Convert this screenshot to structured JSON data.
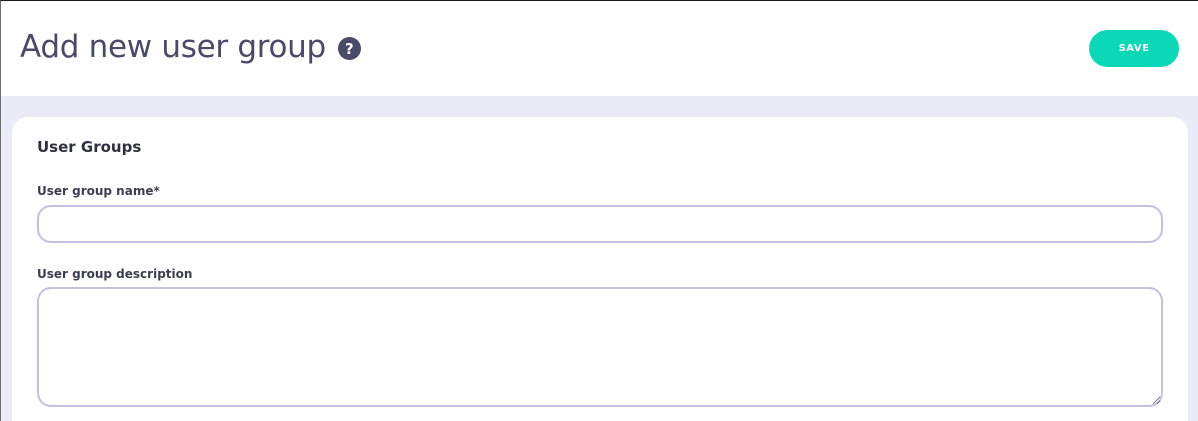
{
  "header": {
    "title": "Add new user group",
    "help_icon": "question-circle-icon",
    "save_label": "SAVE"
  },
  "form": {
    "section_title": "User Groups",
    "name_label": "User group name*",
    "name_value": "",
    "description_label": "User group description",
    "description_value": ""
  },
  "colors": {
    "title": "#4a4a68",
    "accent": "#0bd8b6",
    "background": "#ebebf7",
    "input_border": "#c4c0dd"
  }
}
